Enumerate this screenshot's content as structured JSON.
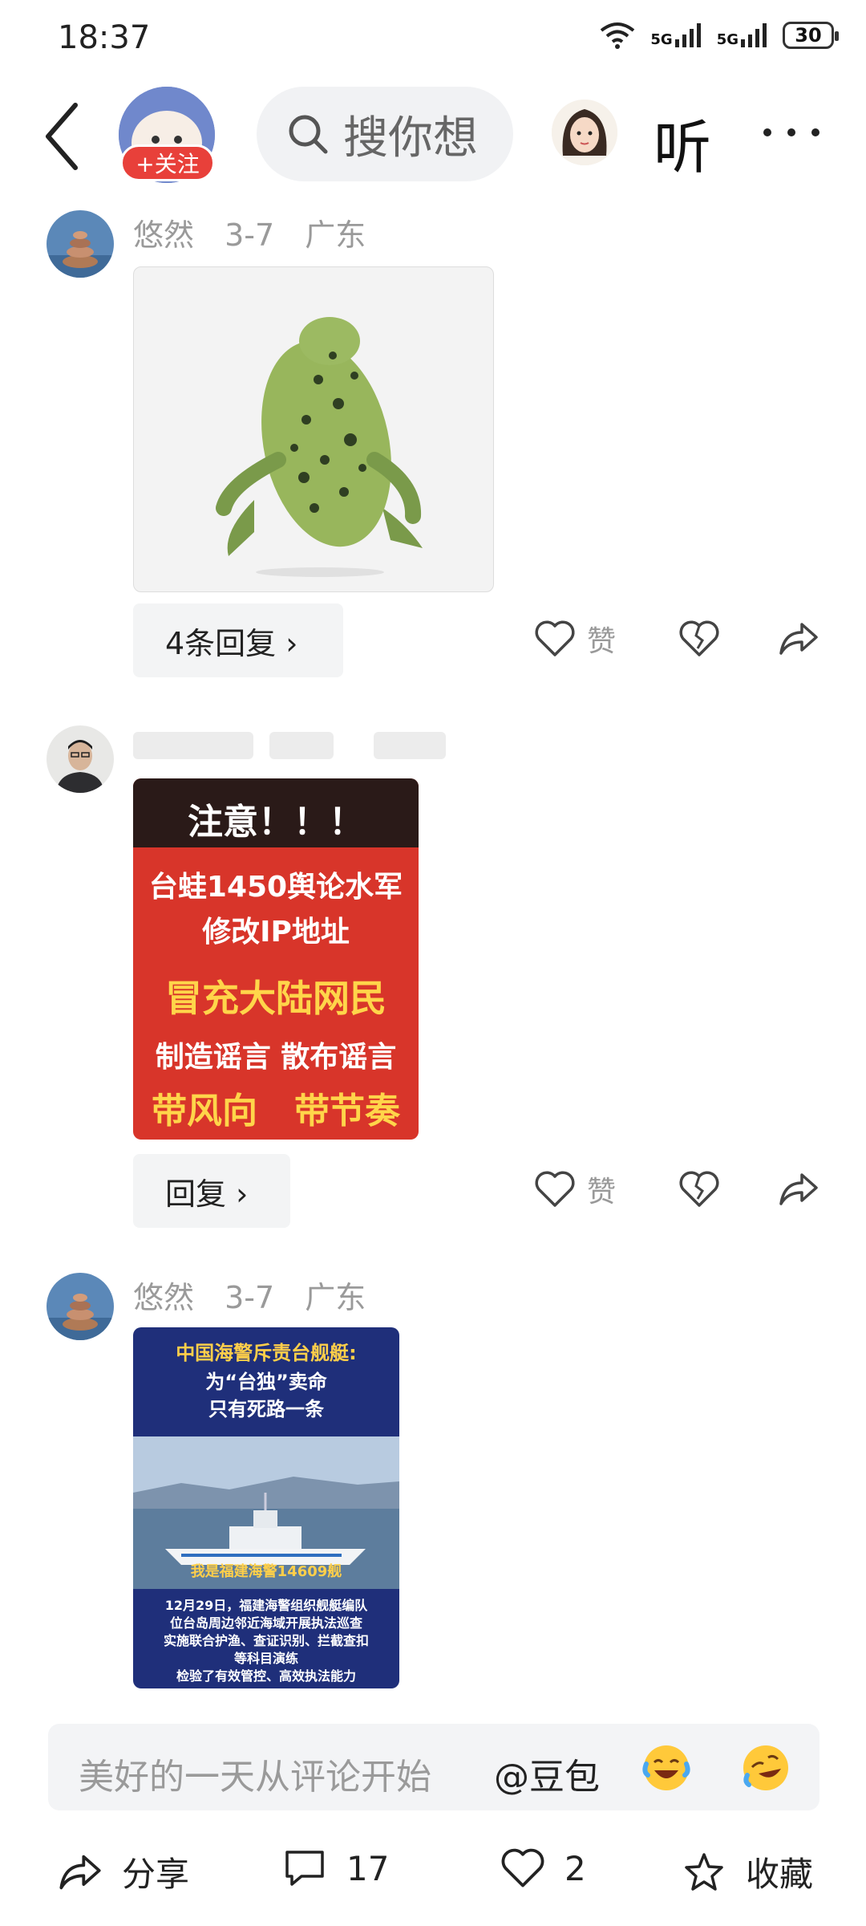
{
  "status_bar": {
    "time": "18:37",
    "net1": "5G",
    "net2": "5G",
    "battery": "30"
  },
  "header": {
    "follow_label": "+关注",
    "search_placeholder": "搜你想",
    "listen_label": "听"
  },
  "comments": [
    {
      "user": "悠然",
      "date": "3-7",
      "location": "广东",
      "reply_label": "4条回复 ›",
      "like_label": "赞"
    },
    {
      "user": "",
      "date": "",
      "location": "",
      "reply_label": "回复 ›",
      "like_label": "赞",
      "poster": {
        "line1": "注意！！！",
        "line2": "台蛙1450舆论水军",
        "line3": "修改IP地址",
        "line4": "冒充大陆网民",
        "line5": "制造谣言 散布谣言",
        "line6a": "带风向",
        "line6b": "带节奏"
      }
    },
    {
      "user": "悠然",
      "date": "3-7",
      "location": "广东",
      "news": {
        "headline1": "中国海警斥责台舰艇:",
        "headline2": "为“台独”卖命",
        "headline3": "只有死路一条",
        "caption": "我是福建海警14609舰",
        "body1": "12月29日，福建海警组织舰艇编队",
        "body2": "位台岛周边邻近海域开展执法巡查",
        "body3": "实施联合护渔、查证识别、拦截查扣",
        "body4": "等科目演练",
        "body5": "检验了有效管控、高效执法能力"
      }
    }
  ],
  "input": {
    "placeholder": "美好的一天从评论开始",
    "mention": "@豆包"
  },
  "bottom_bar": {
    "share": "分享",
    "comments": "17",
    "likes": "2",
    "favorite": "收藏"
  },
  "colors": {
    "follow": "#e8403a",
    "poster_red": "#d8352a",
    "poster_yellow": "#ffd54a",
    "news_blue": "#1f2f7a"
  }
}
